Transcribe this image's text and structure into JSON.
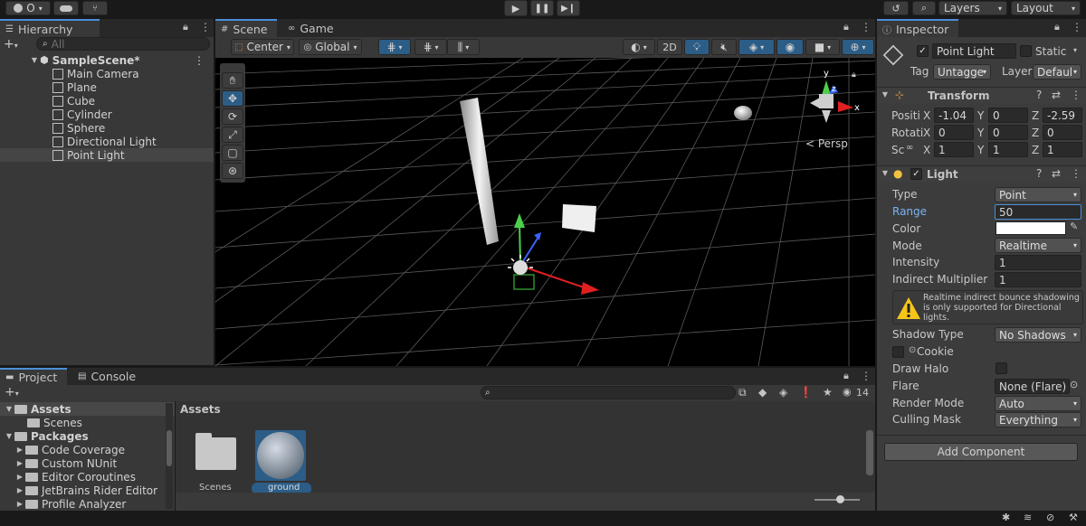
{
  "toolbar": {
    "account_label": "O",
    "layers_label": "Layers",
    "layout_label": "Layout"
  },
  "hierarchy": {
    "tab_label": "Hierarchy",
    "search_placeholder": "All",
    "scene_name": "SampleScene*",
    "items": [
      "Main Camera",
      "Plane",
      "Cube",
      "Cylinder",
      "Sphere",
      "Directional Light",
      "Point Light"
    ],
    "selected": "Point Light"
  },
  "scene_view": {
    "tab_scene": "Scene",
    "tab_game": "Game",
    "pivot_label": "Center",
    "space_label": "Global",
    "mode_2d": "2D",
    "persp_label": "< Persp",
    "gizmo_x": "x",
    "gizmo_y": "y",
    "gizmo_z": "z"
  },
  "project": {
    "tab_project": "Project",
    "tab_console": "Console",
    "badge_count": "14",
    "tree": {
      "assets": "Assets",
      "scenes": "Scenes",
      "packages": "Packages",
      "package_items": [
        "Code Coverage",
        "Custom NUnit",
        "Editor Coroutines",
        "JetBrains Rider Editor",
        "Profile Analyzer"
      ]
    },
    "breadcrumb": "Assets",
    "assets": [
      {
        "name": "Scenes",
        "kind": "folder"
      },
      {
        "name": "ground",
        "kind": "material"
      }
    ]
  },
  "inspector": {
    "tab_label": "Inspector",
    "object_name": "Point Light",
    "static_label": "Static",
    "tag_label": "Tag",
    "tag_value": "Untagge",
    "layer_label": "Layer",
    "layer_value": "Defaul",
    "transform": {
      "title": "Transform",
      "rows": [
        {
          "label": "Positi",
          "x": "-1.04",
          "y": "0",
          "z": "-2.59"
        },
        {
          "label": "Rotati",
          "x": "0",
          "y": "0",
          "z": "0"
        },
        {
          "label": "Sc",
          "x": "1",
          "y": "1",
          "z": "1"
        }
      ],
      "axis_x": "X",
      "axis_y": "Y",
      "axis_z": "Z"
    },
    "light": {
      "title": "Light",
      "type_label": "Type",
      "type_value": "Point",
      "range_label": "Range",
      "range_value": "50",
      "color_label": "Color",
      "color_value": "#ffffff",
      "mode_label": "Mode",
      "mode_value": "Realtime",
      "intensity_label": "Intensity",
      "intensity_value": "1",
      "indirect_label": "Indirect Multiplier",
      "indirect_value": "1",
      "warning": "Realtime indirect bounce shadowing is only supported for Directional lights.",
      "shadow_label": "Shadow Type",
      "shadow_value": "No Shadows",
      "cookie_label": "Cookie",
      "halo_label": "Draw Halo",
      "flare_label": "Flare",
      "flare_value": "None (Flare)",
      "render_label": "Render Mode",
      "render_value": "Auto",
      "culling_label": "Culling Mask",
      "culling_value": "Everything"
    },
    "add_component": "Add Component"
  },
  "colors": {
    "accent": "#4a8fd8",
    "selection": "#2c5d87"
  }
}
